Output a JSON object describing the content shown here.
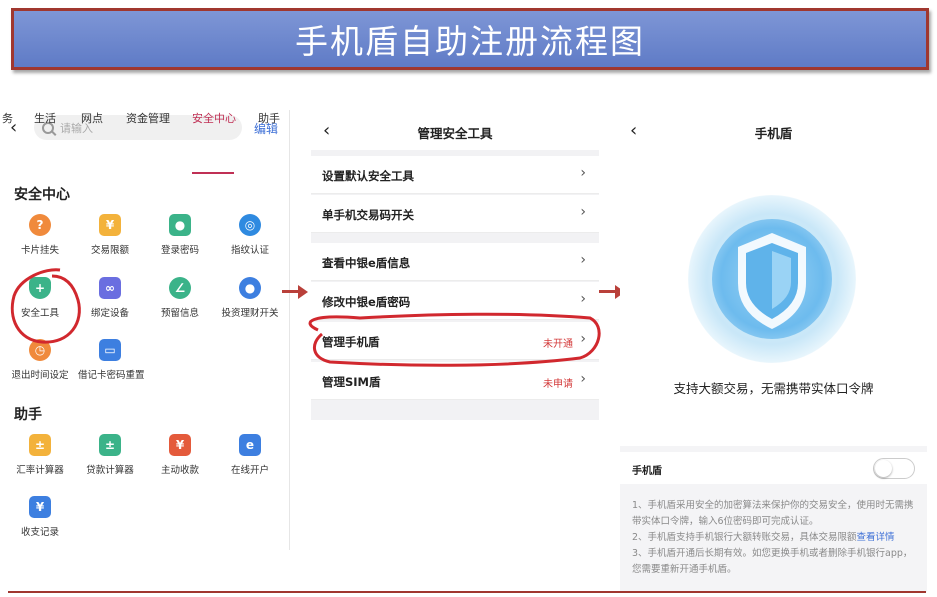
{
  "banner": {
    "title": "手机盾自助注册流程图"
  },
  "panel1": {
    "search_placeholder": "请输入",
    "edit_label": "编辑",
    "tabs": [
      "务",
      "生活",
      "网点",
      "资金管理",
      "安全中心",
      "助手"
    ],
    "active_tab": "安全中心",
    "section1_title": "安全中心",
    "section1_items": [
      "卡片挂失",
      "交易限额",
      "登录密码",
      "指纹认证",
      "安全工具",
      "绑定设备",
      "预留信息",
      "投资理财开关",
      "退出时间设定",
      "借记卡密码重置"
    ],
    "section2_title": "助手",
    "section2_items": [
      "汇率计算器",
      "贷款计算器",
      "主动收款",
      "在线开户",
      "收支记录"
    ]
  },
  "panel2": {
    "title": "管理安全工具",
    "rows": [
      {
        "label": "设置默认安全工具",
        "status": ""
      },
      {
        "label": "单手机交易码开关",
        "status": ""
      },
      {
        "label": "查看中银e盾信息",
        "status": ""
      },
      {
        "label": "修改中银e盾密码",
        "status": ""
      },
      {
        "label": "管理手机盾",
        "status": "未开通"
      },
      {
        "label": "管理SIM盾",
        "status": "未申请"
      }
    ]
  },
  "panel3": {
    "title": "手机盾",
    "description": "支持大额交易，无需携带实体口令牌",
    "toggle_label": "手机盾",
    "toggle_on": false,
    "note1": "1、手机盾采用安全的加密算法来保护你的交易安全，使用时无需携带实体口令牌，输入6位密码即可完成认证。",
    "note2_prefix": "2、手机盾支持手机银行大额转账交易，具体交易限额",
    "note2_link": "查看详情",
    "note3": "3、手机盾开通后长期有效。如您更换手机或者删除手机银行app，您需要重新开通手机盾。"
  },
  "colors": {
    "banner": "#6c86cc",
    "accent_red": "#c03055",
    "status_red": "#d33a3a",
    "link_blue": "#3d6fd6",
    "annotation_red": "#d1282e"
  }
}
